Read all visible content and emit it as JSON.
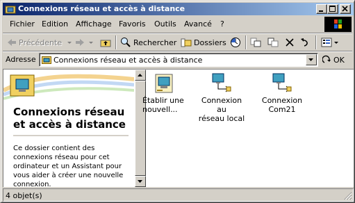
{
  "window": {
    "title": "Connexions réseau et accès à distance"
  },
  "menu": [
    "Fichier",
    "Edition",
    "Affichage",
    "Favoris",
    "Outils",
    "Avancé",
    "?"
  ],
  "toolbar": {
    "back_label": "Précédente",
    "search_label": "Rechercher",
    "folders_label": "Dossiers"
  },
  "address": {
    "label": "Adresse",
    "value": "Connexions réseau et accès à distance",
    "go_label": "OK"
  },
  "left_pane": {
    "title_line1": "Connexions réseau",
    "title_line2": "et accès à distance",
    "description": "Ce dossier contient des connexions réseau pour cet ordinateur et un Assistant pour vous aider à créer une nouvelle connexion."
  },
  "items": [
    {
      "label_line1": "Établir une",
      "label_line2": "nouvell...",
      "icon": "new-connection-icon"
    },
    {
      "label_line1": "Connexion au",
      "label_line2": "réseau local",
      "icon": "network-connection-icon"
    },
    {
      "label_line1": "Connexion",
      "label_line2": "Com21",
      "icon": "network-connection-icon"
    }
  ],
  "status": {
    "text": "4 objet(s)"
  },
  "colors": {
    "title_start": "#0a246a",
    "title_end": "#a6caf0",
    "face": "#d4d0c8"
  }
}
